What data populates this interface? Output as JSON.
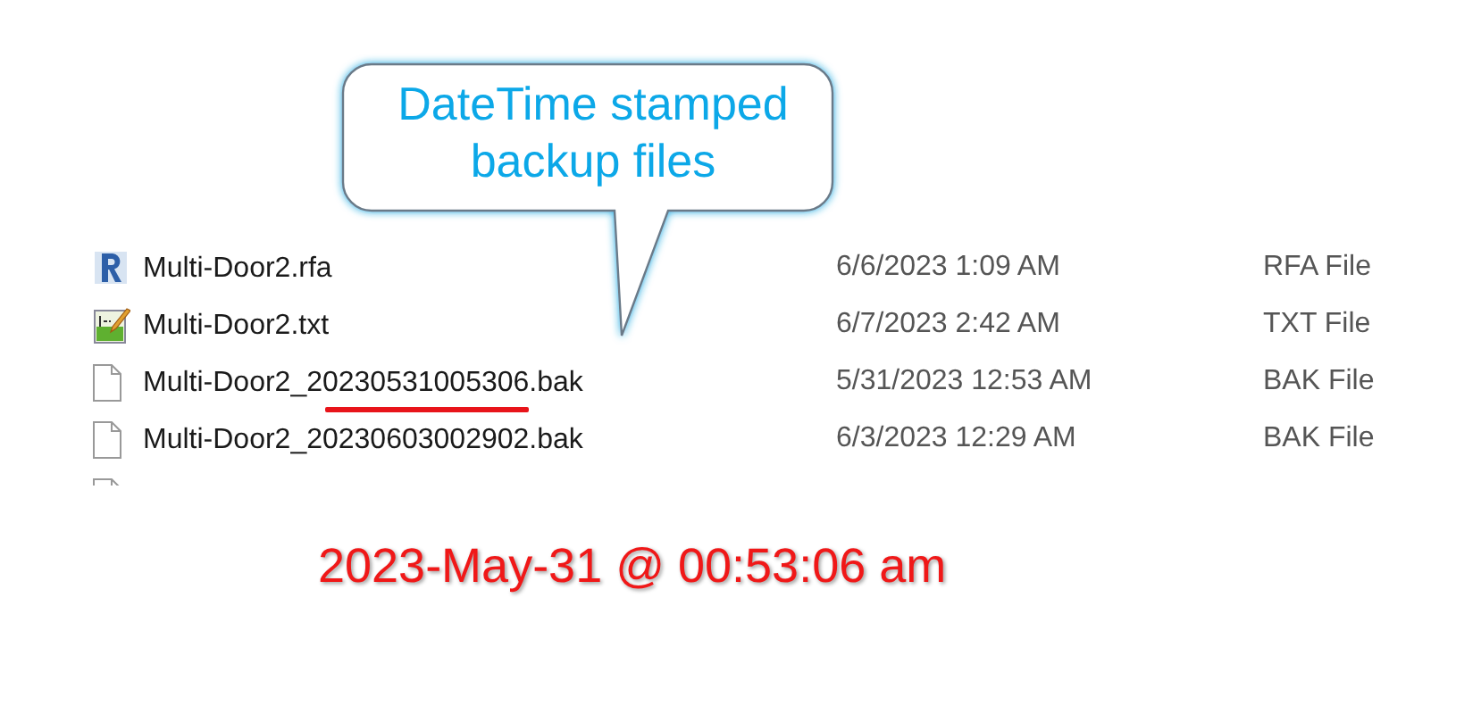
{
  "files": [
    {
      "kind": "revit",
      "name": "Multi-Door2.rfa",
      "modified": "6/6/2023 1:09 AM",
      "type": "RFA File",
      "underlined": false
    },
    {
      "kind": "notepad",
      "name": "Multi-Door2.txt",
      "modified": "6/7/2023 2:42 AM",
      "type": "TXT File",
      "underlined": false
    },
    {
      "kind": "file",
      "name": "Multi-Door2_20230531005306.bak",
      "modified": "5/31/2023 12:53 AM",
      "type": "BAK File",
      "underlined": true
    },
    {
      "kind": "file",
      "name": "Multi-Door2_20230603002902.bak",
      "modified": "6/3/2023 12:29 AM",
      "type": "BAK File",
      "underlined": false
    },
    {
      "kind": "file"
    }
  ],
  "callout": {
    "text": "DateTime stamped backup files"
  },
  "caption": "2023-May-31 @ 00:53:06 am"
}
